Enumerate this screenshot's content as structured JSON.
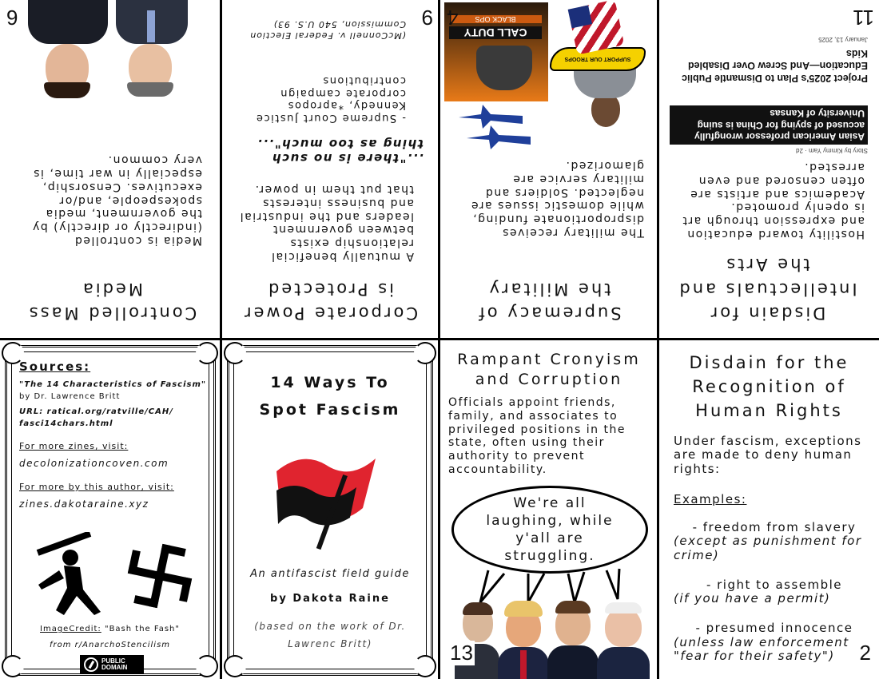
{
  "zine": {
    "title": "14 Ways To Spot Fascism",
    "subtitle": "An antifascist field guide",
    "author": "by Dakota Raine",
    "credit": "(based on the work of Dr. Lawrenc Britt)"
  },
  "sources": {
    "heading": "Sources:",
    "work": "\"The 14 Characteristics of Fascism\"",
    "by": "by Dr. Lawrence Britt",
    "url": "URL: ratical.org/ratville/CAH/ fasci14chars.html",
    "more_zines_label": "For more zines, visit:",
    "more_zines_site": "decolonizationcoven.com",
    "more_author_label": "For more by this author, visit:",
    "more_author_site": "zines.dakotaraine.xyz",
    "image_credit_label": "ImageCredit:",
    "image_credit_title": "\"Bash the Fash\"",
    "image_credit_from": "from r/AnarchoStencilism",
    "badge_top": "PUBLIC",
    "badge_bottom": "DOMAIN"
  },
  "page12": {
    "title": "Disdain for the Recognition of Human Rights",
    "intro": "Under fascism, exceptions are made to deny human rights:",
    "examples_heading": "Examples:",
    "ex1": "- freedom from slavery",
    "ex1_note": "(except as punishment for crime)",
    "ex2": "- right to assemble",
    "ex2_note": "(if you have a permit)",
    "ex3": "- presumed innocence",
    "ex3_note": "(unless law enforcement \"fear for their safety\")",
    "number": "2"
  },
  "page13": {
    "title": "Rampant Cronyism and Corruption",
    "body": "Officials appoint friends, family, and associates to privileged positions in the state, often using their authority to prevent accountability.",
    "bubble": "We're all laughing, while y'all are struggling.",
    "number": "13"
  },
  "page3": {
    "title": "Controlled Mass Media",
    "body": "Media is controlled (indirectly or directly) by the government, media spokespeople, and/or executives. Censorship, especially in war time, is very common.",
    "number": "6"
  },
  "page9": {
    "title": "Corporate Power is Protected",
    "body": "A mutually beneficial relationship exists between government leaders and the industrial and business interests that put them in power.",
    "quote": "...\"there is no such thing as too much\"...",
    "attribution": "- Supreme Court Justice Kennedy, *apropos corporate campaign contributions",
    "citation": "(McConnell v. Federal Election Commission, 540 U.S. 93)",
    "number": "9"
  },
  "page4": {
    "title": "Supremacy of the Military",
    "body": "The military receives disproportionate funding, while domestic issues are neglected. Soldiers and military service are glamorized.",
    "game_logo": "CALL DUTY",
    "game_sub": "BLACK OPS",
    "banner": "SUPPORT OUR TROOPS",
    "number": "4"
  },
  "page11": {
    "title": "Disdain for Intellectuals and the Arts",
    "body": "Hostility toward education and expression through art is openly promoted. Academics and artists are often censored and even arrested.",
    "clip_headline": "Asian American professor wrongfully accused of spying for China is suing University of Kansas",
    "clip_byline": "Story by Kimmy Yam · 2d",
    "clip2_headline": "Project 2025's Plan to Dismantle Public Education—And Screw Over Disabled Kids",
    "clip2_date": "January 13, 2025",
    "number": "11"
  },
  "colors": {
    "flag_red": "#e0242f",
    "flag_black": "#111111",
    "banner_yellow": "#f5d100",
    "ink": "#111111"
  }
}
